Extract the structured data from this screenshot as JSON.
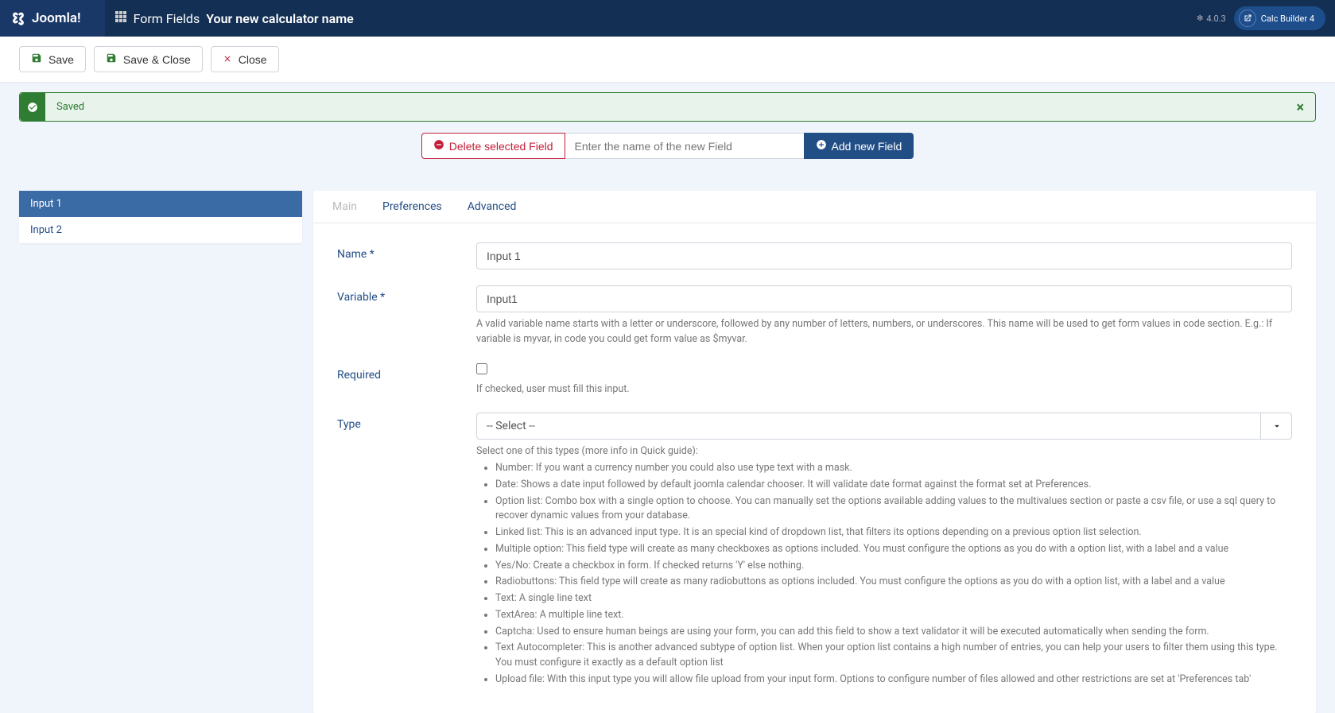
{
  "brand": "Joomla!",
  "header": {
    "prefix": "Form Fields",
    "name": "Your new calculator name",
    "version_logo": "⌘",
    "version": "4.0.3",
    "badge": "Calc Builder 4"
  },
  "toolbar": {
    "save": "Save",
    "save_close": "Save & Close",
    "close": "Close"
  },
  "alert": {
    "text": "Saved"
  },
  "field_actions": {
    "delete": "Delete selected Field",
    "placeholder": "Enter the name of the new Field",
    "add": "Add new Field"
  },
  "sidebar": {
    "items": [
      {
        "label": "Input 1",
        "active": true
      },
      {
        "label": "Input 2",
        "active": false
      }
    ]
  },
  "tabs": [
    {
      "label": "Main",
      "active": true
    },
    {
      "label": "Preferences",
      "active": false
    },
    {
      "label": "Advanced",
      "active": false
    }
  ],
  "form": {
    "name_label": "Name *",
    "name_value": "Input 1",
    "variable_label": "Variable *",
    "variable_value": "Input1",
    "variable_help": "A valid variable name starts with a letter or underscore, followed by any number of letters, numbers, or underscores. This name will be used to get form values in code section. E.g.: If variable is myvar, in code you could get form value as $myvar.",
    "required_label": "Required",
    "required_help": "If checked, user must fill this input.",
    "type_label": "Type",
    "type_value": "-- Select --",
    "type_help_intro": "Select one of this types (more info in Quick guide):",
    "type_help_items": [
      "Number: If you want a currency number you could also use type text with a mask.",
      "Date: Shows a date input followed by default joomla calendar chooser. It will validate date format against the format set at Preferences.",
      "Option list: Combo box with a single option to choose. You can manually set the options available adding values to the multivalues section or paste a csv file, or use a sql query to recover dynamic values from your database.",
      "Linked list: This is an advanced input type. It is an special kind of dropdown list, that filters its options depending on a previous option list selection.",
      "Multiple option: This field type will create as many checkboxes as options included. You must configure the options as you do with a option list, with a label and a value",
      "Yes/No: Create a checkbox in form. If checked returns 'Y' else nothing.",
      "Radiobuttons: This field type will create as many radiobuttons as options included. You must configure the options as you do with a option list, with a label and a value",
      "Text: A single line text",
      "TextArea: A multiple line text.",
      "Captcha: Used to ensure human beings are using your form, you can add this field to show a text validator it will be executed automatically when sending the form.",
      "Text Autocompleter: This is another advanced subtype of option list. When your option list contains a high number of entries, you can help your users to filter them using this type. You must configure it exactly as a default option list",
      "Upload file: With this input type you will allow file upload from your input form. Options to configure number of files allowed and other restrictions are set at 'Preferences tab'"
    ]
  }
}
